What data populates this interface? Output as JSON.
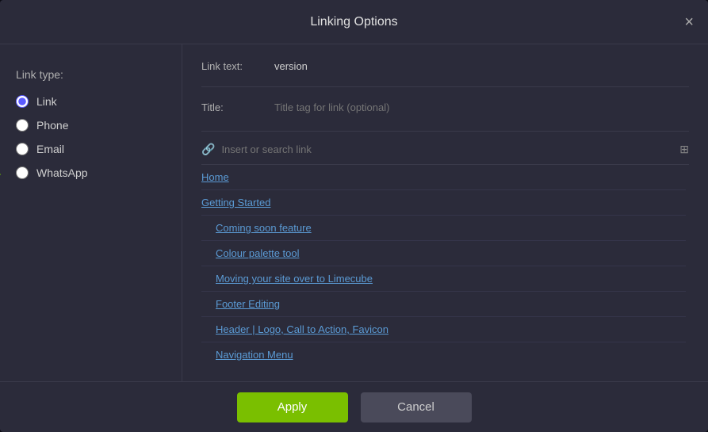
{
  "modal": {
    "title": "Linking Options",
    "close_icon": "×"
  },
  "sidebar": {
    "link_type_label": "Link type:",
    "options": [
      {
        "id": "link",
        "label": "Link",
        "checked": true
      },
      {
        "id": "phone",
        "label": "Phone",
        "checked": false
      },
      {
        "id": "email",
        "label": "Email",
        "checked": false
      },
      {
        "id": "whatsapp",
        "label": "WhatsApp",
        "checked": false
      }
    ]
  },
  "main": {
    "link_text_label": "Link text:",
    "link_text_value": "version",
    "title_label": "Title:",
    "title_placeholder": "Title tag for link (optional)",
    "search_placeholder": "Insert or search link",
    "links": [
      {
        "id": "home",
        "label": "Home",
        "level": "top"
      },
      {
        "id": "getting-started",
        "label": "Getting Started",
        "level": "top"
      },
      {
        "id": "coming-soon",
        "label": "Coming soon feature",
        "level": "sub"
      },
      {
        "id": "colour-palette",
        "label": "Colour palette tool",
        "level": "sub"
      },
      {
        "id": "moving-site",
        "label": "Moving your site over to Limecube",
        "level": "sub"
      },
      {
        "id": "footer-editing",
        "label": "Footer Editing",
        "level": "sub"
      },
      {
        "id": "header-logo",
        "label": "Header | Logo, Call to Action, Favicon",
        "level": "sub"
      },
      {
        "id": "navigation-menu",
        "label": "Navigation Menu",
        "level": "sub"
      },
      {
        "id": "placeholder-1",
        "label": "...",
        "level": "sub"
      }
    ]
  },
  "footer": {
    "apply_label": "Apply",
    "cancel_label": "Cancel"
  }
}
